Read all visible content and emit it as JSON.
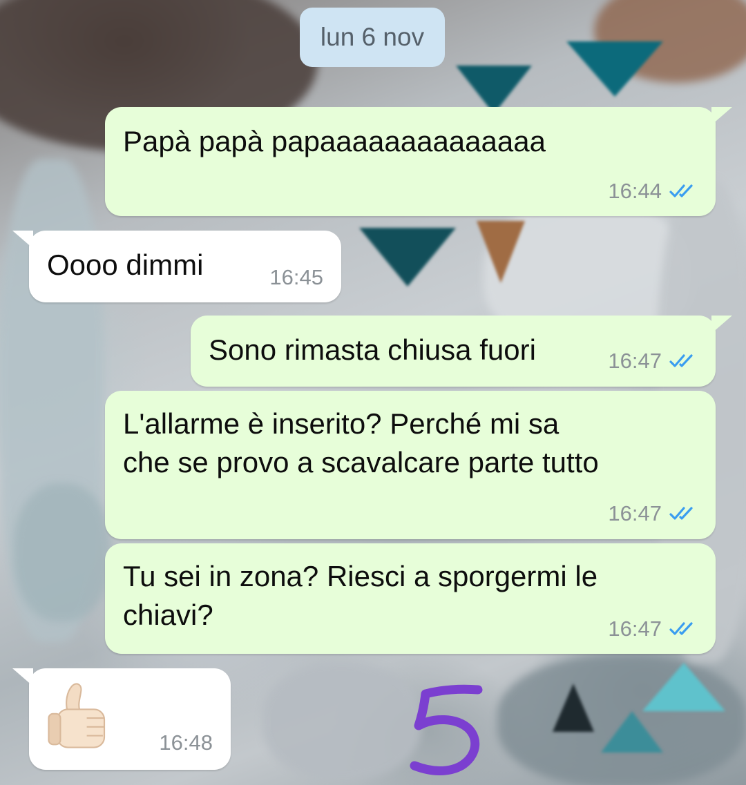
{
  "date_chip": "lun 6 nov",
  "messages": [
    {
      "direction": "out",
      "text": "Papà papà papaaaaaaaaaaaaaa",
      "time": "16:44",
      "read": true
    },
    {
      "direction": "in",
      "text": "Oooo dimmi",
      "time": "16:45"
    },
    {
      "direction": "out",
      "text": "Sono rimasta chiusa fuori",
      "time": "16:47",
      "read": true
    },
    {
      "direction": "out",
      "text": "L'allarme è inserito? Perché mi sa\nche se provo a scavalcare parte tutto",
      "time": "16:47",
      "read": true
    },
    {
      "direction": "out",
      "text": "Tu sei in zona? Riesci a sporgermi le\nchiavi?",
      "time": "16:47",
      "read": true
    },
    {
      "direction": "in",
      "emoji": "thumbs-up-icon",
      "time": "16:48"
    }
  ],
  "annotation": {
    "icon": "handwritten-number-5",
    "color": "#7b3fd0"
  },
  "colors": {
    "outgoing_bubble": "#e7fed9",
    "incoming_bubble": "#ffffff",
    "date_chip": "#cfe4f3",
    "read_ticks": "#3a9df0"
  }
}
